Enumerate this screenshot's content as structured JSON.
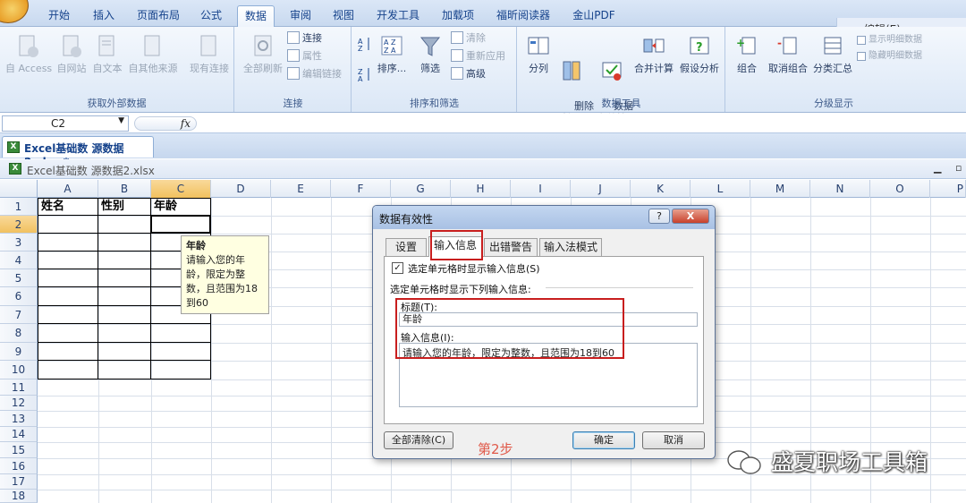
{
  "ribbon_tabs": [
    "开始",
    "插入",
    "页面布局",
    "公式",
    "数据",
    "审阅",
    "视图",
    "开发工具",
    "加载项",
    "福昕阅读器",
    "金山PDF"
  ],
  "help_label": "编辑(E)",
  "groups": {
    "external": {
      "label": "获取外部数据",
      "buttons": [
        "自 Access",
        "自网站",
        "自文本",
        "自其他来源",
        "现有连接"
      ]
    },
    "connection": {
      "label": "连接",
      "big": "全部刷新",
      "small": [
        "连接",
        "属性",
        "编辑链接"
      ]
    },
    "sort": {
      "label": "排序和筛选",
      "sort": "排序...",
      "filter": "筛选",
      "small": [
        "清除",
        "重新应用",
        "高级"
      ]
    },
    "tools": {
      "label": "数据工具",
      "buttons": [
        "分列",
        "删除\n重复项",
        "数据\n有效性",
        "合并计算",
        "假设分析"
      ]
    },
    "outline": {
      "label": "分级显示",
      "buttons": [
        "组合",
        "取消组合",
        "分类汇总"
      ],
      "small": [
        "显示明细数据",
        "隐藏明细数据"
      ]
    }
  },
  "name_box": "C2",
  "fx": "fx",
  "file_tab": "Excel基础数 源数据2.xlsx *",
  "workbook_title": "Excel基础数 源数据2.xlsx",
  "columns": [
    "A",
    "B",
    "C",
    "D",
    "E",
    "F",
    "G",
    "H",
    "I",
    "J",
    "K",
    "L",
    "M",
    "N",
    "O",
    "P"
  ],
  "rows": [
    "1",
    "2",
    "3",
    "4",
    "5",
    "6",
    "7",
    "8",
    "9",
    "10",
    "11",
    "12",
    "13",
    "14",
    "15",
    "16",
    "17",
    "18"
  ],
  "cells": {
    "a1": "姓名",
    "b1": "性别",
    "c1": "年龄"
  },
  "tooltip": {
    "title": "年龄",
    "body": "请输入您的年龄，限定为整数，且范围为18到60"
  },
  "dialog": {
    "title": "数据有效性",
    "help": "?",
    "close": "X",
    "tabs": [
      "设置",
      "输入信息",
      "出错警告",
      "输入法模式"
    ],
    "show_checkbox": "选定单元格时显示输入信息(S)",
    "section": "选定单元格时显示下列输入信息:",
    "title_label": "标题(T):",
    "title_value": "年龄",
    "msg_label": "输入信息(I):",
    "msg_value": "请输入您的年龄，限定为整数，且范围为18到60",
    "step": "第2步",
    "clear": "全部清除(C)",
    "ok": "确定",
    "cancel": "取消"
  },
  "watermark": "盛夏职场工具箱"
}
